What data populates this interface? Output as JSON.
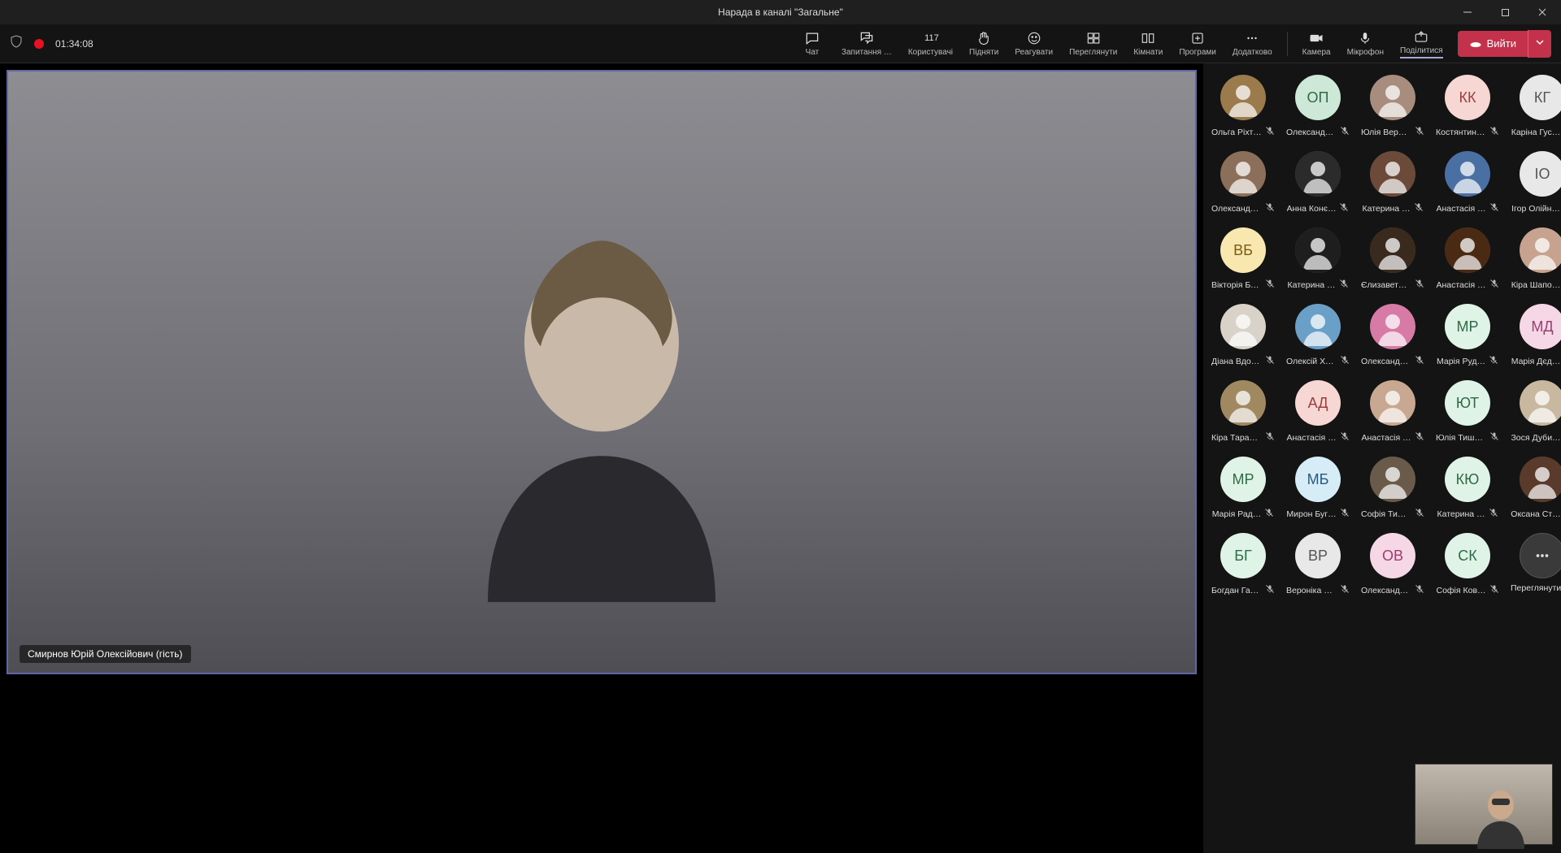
{
  "window": {
    "title": "Нарада в каналі \"Загальне\""
  },
  "recording": {
    "time": "01:34:08"
  },
  "toolbar": {
    "chat": "Чат",
    "qa": "Запитання …",
    "people": "Користувачі",
    "people_count": "117",
    "raise": "Підняти",
    "react": "Реагувати",
    "view": "Переглянути",
    "rooms": "Кімнати",
    "apps": "Програми",
    "more": "Додатково",
    "camera": "Камера",
    "mic": "Мікрофон",
    "share": "Поділитися",
    "leave": "Вийти"
  },
  "mainSpeaker": {
    "name": "Смирнов Юрій Олексійович (гість)"
  },
  "moreTile": "Переглянути в…",
  "participants": [
    {
      "name": "Ольга Ріхтер",
      "type": "photo",
      "bg": "#9b7b4c"
    },
    {
      "name": "Олександр…",
      "type": "initials",
      "initials": "ОП",
      "bg": "#cde8d6",
      "fg": "#2f6b46"
    },
    {
      "name": "Юлія Верш…",
      "type": "photo",
      "bg": "#a88c7d"
    },
    {
      "name": "Костянтин …",
      "type": "initials",
      "initials": "КК",
      "bg": "#f6d7d3",
      "fg": "#9a3e3e"
    },
    {
      "name": "Каріна Гус…",
      "type": "initials",
      "initials": "КГ",
      "bg": "#e8e8e8",
      "fg": "#555"
    },
    {
      "name": "Олександр…",
      "type": "photo",
      "bg": "#8c6f5a"
    },
    {
      "name": "Анна Конє…",
      "type": "photo",
      "bg": "#2b2b2b"
    },
    {
      "name": "Катерина …",
      "type": "photo",
      "bg": "#6c4a3a"
    },
    {
      "name": "Анастасія …",
      "type": "photo",
      "bg": "#4a6fa3"
    },
    {
      "name": "Ігор Олійн…",
      "type": "initials",
      "initials": "ІО",
      "bg": "#e8e8e8",
      "fg": "#555"
    },
    {
      "name": "Вікторія Бу…",
      "type": "initials",
      "initials": "ВБ",
      "bg": "#f9e7b0",
      "fg": "#7a5b12"
    },
    {
      "name": "Катерина …",
      "type": "photo",
      "bg": "#1e1e1e"
    },
    {
      "name": "Єлизавета …",
      "type": "photo",
      "bg": "#3a2a1e"
    },
    {
      "name": "Анастасія …",
      "type": "photo",
      "bg": "#4a2a12"
    },
    {
      "name": "Кіра Шапо…",
      "type": "photo",
      "bg": "#c7a28e"
    },
    {
      "name": "Діана Вдов…",
      "type": "photo",
      "bg": "#d8d2c8"
    },
    {
      "name": "Олексій Хо…",
      "type": "photo",
      "bg": "#6aa0c8"
    },
    {
      "name": "Олександр…",
      "type": "photo",
      "bg": "#d77aa6"
    },
    {
      "name": "Марія Руд…",
      "type": "initials",
      "initials": "МР",
      "bg": "#dff3e6",
      "fg": "#2f6b46"
    },
    {
      "name": "Марія Дєд…",
      "type": "initials",
      "initials": "МД",
      "bg": "#f6d7e6",
      "fg": "#9a3e6e"
    },
    {
      "name": "Кіра Тарас…",
      "type": "photo",
      "bg": "#a08860"
    },
    {
      "name": "Анастасія …",
      "type": "initials",
      "initials": "АД",
      "bg": "#f6d7d3",
      "fg": "#9a3e3e"
    },
    {
      "name": "Анастасія …",
      "type": "photo",
      "bg": "#c8a890"
    },
    {
      "name": "Юлія Тишк…",
      "type": "initials",
      "initials": "ЮТ",
      "bg": "#dff3e6",
      "fg": "#2f6b46"
    },
    {
      "name": "Зося Дуби…",
      "type": "photo",
      "bg": "#c8b8a0"
    },
    {
      "name": "Марія Рад…",
      "type": "initials",
      "initials": "МР",
      "bg": "#dff3e6",
      "fg": "#2f6b46"
    },
    {
      "name": "Мирон Буг…",
      "type": "initials",
      "initials": "МБ",
      "bg": "#d6ecf7",
      "fg": "#2a5a7a"
    },
    {
      "name": "Софія Тиш…",
      "type": "photo",
      "bg": "#6a5a4a"
    },
    {
      "name": "Катерина …",
      "type": "initials",
      "initials": "КЮ",
      "bg": "#dff3e6",
      "fg": "#2f6b46"
    },
    {
      "name": "Оксана Ст…",
      "type": "photo",
      "bg": "#5a3a2a"
    },
    {
      "name": "Богдан Гал…",
      "type": "initials",
      "initials": "БГ",
      "bg": "#dff3e6",
      "fg": "#2f6b46"
    },
    {
      "name": "Вероніка Р…",
      "type": "initials",
      "initials": "ВР",
      "bg": "#e8e8e8",
      "fg": "#555"
    },
    {
      "name": "Олександр…",
      "type": "initials",
      "initials": "ОВ",
      "bg": "#f6d7e6",
      "fg": "#9a3e6e"
    },
    {
      "name": "Софія Ков…",
      "type": "initials",
      "initials": "СК",
      "bg": "#dff3e6",
      "fg": "#2f6b46"
    }
  ]
}
